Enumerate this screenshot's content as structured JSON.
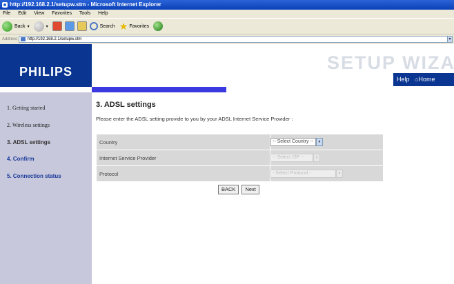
{
  "window": {
    "title": "http://192.168.2.1/setupw.stm - Microsoft Internet Explorer"
  },
  "menu": [
    "File",
    "Edit",
    "View",
    "Favorites",
    "Tools",
    "Help"
  ],
  "toolbar": {
    "back_label": "Back",
    "search_label": "Search",
    "favorites_label": "Favorites"
  },
  "address": {
    "label": "Address",
    "url": "http://192.168.2.1/setupw.stm"
  },
  "header": {
    "logo": "PHILIPS",
    "wizard_title": "SETUP WIZA",
    "help_label": "Help",
    "home_label": "Home"
  },
  "sidebar": {
    "items": [
      {
        "label": "1. Getting started"
      },
      {
        "label": "2. Wireless settings"
      },
      {
        "label": "3. ADSL settings"
      },
      {
        "label": "4. Confirm"
      },
      {
        "label": "5. Connection status"
      }
    ]
  },
  "main": {
    "heading": "3. ADSL settings",
    "intro": "Please enter the ADSL setting provide to you by your ADSL Internet Service Provider :",
    "rows": [
      {
        "label": "Country",
        "value": "-- Select Country --"
      },
      {
        "label": "Internet Service Provider",
        "value": "-- Select ISP --"
      },
      {
        "label": "Protocol",
        "value": "- Select Protocol -"
      }
    ],
    "back_label": "BACK",
    "next_label": "Next"
  },
  "colors": {
    "brand_blue": "#0a3590",
    "sidebar_bg": "#c8c8dc",
    "accent_strip": "#3a3ae0"
  }
}
